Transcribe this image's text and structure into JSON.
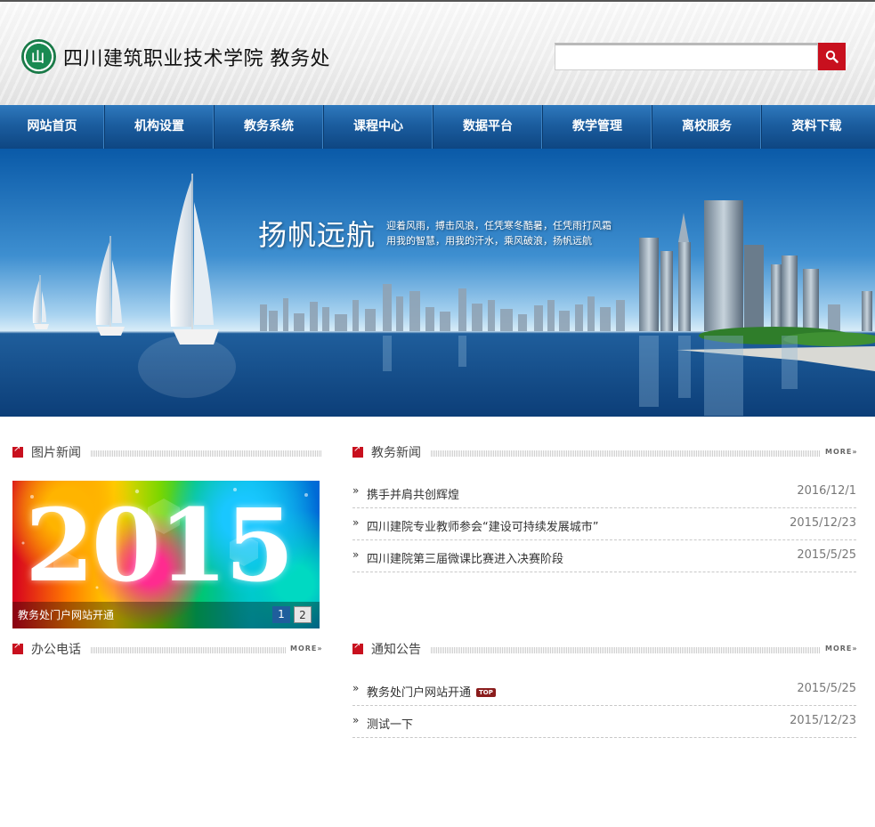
{
  "header": {
    "site_title": "四川建筑职业技术学院 教务处",
    "search_placeholder": "",
    "search_value": ""
  },
  "nav": {
    "items": [
      "网站首页",
      "机构设置",
      "教务系统",
      "课程中心",
      "数据平台",
      "教学管理",
      "离校服务",
      "资料下载"
    ]
  },
  "banner": {
    "title": "扬帆远航",
    "line1": "迎着风雨，搏击风浪，任凭寒冬酷暑，任凭雨打风霜",
    "line2": "用我的智慧，用我的汗水，乘风破浪，扬帆远航"
  },
  "photo_news": {
    "title": "图片新闻",
    "slide_text": "2015",
    "caption": "教务处门户网站开通",
    "pages": [
      "1",
      "2"
    ]
  },
  "office_phone": {
    "title": "办公电话",
    "more": "MORE»"
  },
  "academic_news": {
    "title": "教务新闻",
    "more": "MORE»",
    "items": [
      {
        "text": "携手并肩共创辉煌",
        "date": "2016/12/1"
      },
      {
        "text": "四川建院专业教师参会“建设可持续发展城市”",
        "date": "2015/12/23"
      },
      {
        "text": "四川建院第三届微课比赛进入决赛阶段",
        "date": "2015/5/25"
      }
    ]
  },
  "notices": {
    "title": "通知公告",
    "more": "MORE»",
    "items": [
      {
        "text": "教务处门户网站开通",
        "date": "2015/5/25",
        "badge": "TOP"
      },
      {
        "text": "测试一下",
        "date": "2015/12/23"
      }
    ]
  },
  "colors": {
    "accent_red": "#c8101e",
    "nav_blue": "#1b5d9f",
    "logo_green": "#1a8a52"
  },
  "icons": {
    "search": "magnifier-icon",
    "section_marker": "arrow-up-right-icon",
    "list_bullet": "double-chevron-right-icon"
  }
}
